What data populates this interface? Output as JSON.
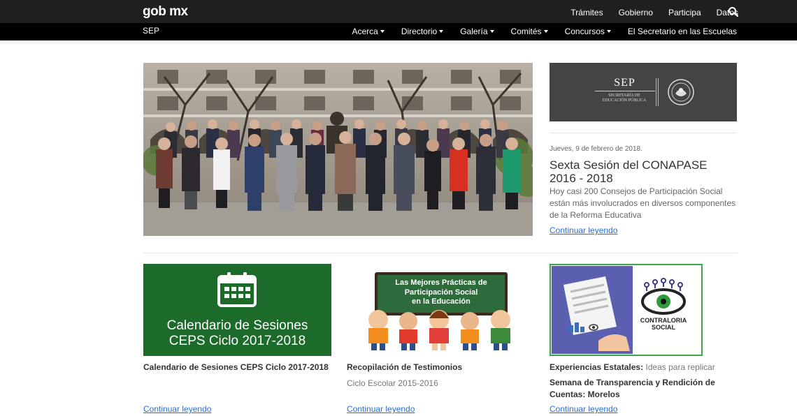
{
  "header": {
    "logo": "gob mx",
    "links": [
      "Trámites",
      "Gobierno",
      "Participa",
      "Datos"
    ],
    "search_icon": "search-icon"
  },
  "subheader": {
    "title": "SEP",
    "nav": [
      "Acerca",
      "Directorio",
      "Galería",
      "Comités",
      "Concursos"
    ],
    "nav_last": "El Secretario en las Escuelas"
  },
  "sep_banner": {
    "title": "SEP",
    "subtitle_line1": "SECRETARÍA DE",
    "subtitle_line2": "EDUCACIÓN PÚBLICA"
  },
  "featured": {
    "date": "Jueves, 9 de febrero de 2018.",
    "title": "Sexta Sesión del CONAPASE 2016 - 2018",
    "body": "Hoy casi 200 Consejos de Participación Social están más involucrados en diversos componentes de la Reforma Educativa",
    "link": "Continuar leyendo"
  },
  "cards": [
    {
      "image_text_line1": "Calendario de Sesiones",
      "image_text_line2": "CEPS Ciclo 2017-2018",
      "title": "Calendario de Sesiones CEPS Ciclo 2017-2018",
      "link": "Continuar leyendo"
    },
    {
      "image_text_line1": "Las Mejores Prácticas de",
      "image_text_line2": "Participación Social",
      "image_text_line3": "en la Educación",
      "title": "Recopilación de Testimonios",
      "subtitle": "Ciclo Escolar 2015-2016",
      "link": "Continuar leyendo"
    },
    {
      "image_text_line1": "CONTRALORIA",
      "image_text_line2": "SOCIAL",
      "title_bold": "Experiencias Estatales:",
      "title_rest": " Ideas para replicar",
      "title2": "Semana de Transparencia y Rendición de Cuentas: Morelos",
      "link": "Continuar leyendo"
    }
  ]
}
